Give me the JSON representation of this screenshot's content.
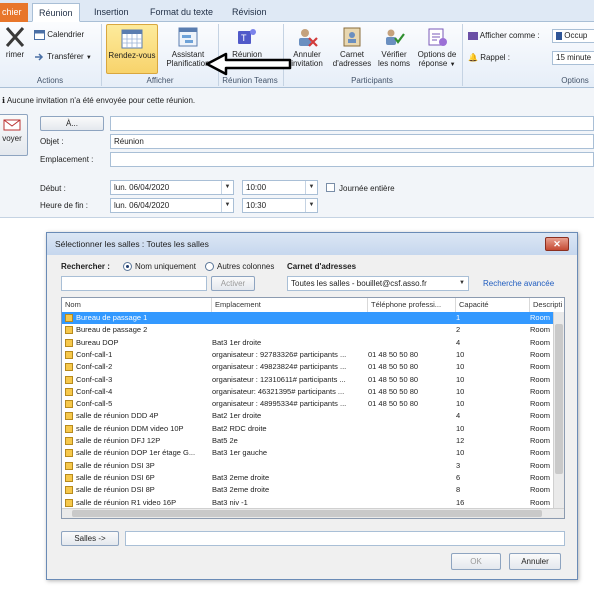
{
  "tabs": [
    "chier",
    "Réunion",
    "Insertion",
    "Format du texte",
    "Révision"
  ],
  "ribbon": {
    "actions": {
      "delete": "rimer",
      "calendar": "Calendrier",
      "forward": "Transférer",
      "group": "Actions"
    },
    "afficher": {
      "rdv": "Rendez-vous",
      "assistant1": "Assistant",
      "assistant2": "Planification",
      "group": "Afficher"
    },
    "teams": {
      "btn": "Réunion",
      "group": "Réunion Teams"
    },
    "participants": {
      "cancel1": "Annuler",
      "cancel2": "invitation",
      "book1": "Carnet",
      "book2": "d'adresses",
      "verify1": "Vérifier",
      "verify2": "les noms",
      "options1": "Options de",
      "options2": "réponse",
      "group": "Participants"
    },
    "options": {
      "show_as_label": "Afficher comme :",
      "show_as_value": "Occup",
      "reminder_label": "Rappel :",
      "reminder_value": "15 minute",
      "group": "Options"
    }
  },
  "form": {
    "info": "Aucune invitation n'a été envoyée pour cette réunion.",
    "send": "voyer",
    "to": "À...",
    "subject_label": "Objet :",
    "subject_value": "Réunion",
    "location_label": "Emplacement :",
    "start_label": "Début :",
    "start_date": "lun. 06/04/2020",
    "start_time": "10:00",
    "allday": "Journée entière",
    "end_label": "Heure de fin :",
    "end_date": "lun. 06/04/2020",
    "end_time": "10:30"
  },
  "dialog": {
    "title": "Sélectionner les salles : Toutes les salles",
    "search_label": "Rechercher :",
    "name_only": "Nom uniquement",
    "other_cols": "Autres colonnes",
    "address_book_label": "Carnet d'adresses",
    "activate": "Activer",
    "book_value": "Toutes les salles - bouillet@csf.asso.fr",
    "advanced": "Recherche avancée",
    "columns": [
      "Nom",
      "Emplacement",
      "Téléphone professi...",
      "Capacité",
      "Descripti"
    ],
    "rows": [
      [
        "Bureau de passage 1",
        "",
        "",
        "1",
        "Room"
      ],
      [
        "Bureau de passage 2",
        "",
        "",
        "2",
        "Room"
      ],
      [
        "Bureau DOP",
        "Bat3 1er droite",
        "",
        "4",
        "Room"
      ],
      [
        "Conf-call-1",
        "organisateur : 92783326# participants ...",
        "01 48 50 50 80",
        "10",
        "Room"
      ],
      [
        "Conf-call-2",
        "organisateur : 49823824# participants ...",
        "01 48 50 50 80",
        "10",
        "Room"
      ],
      [
        "Conf-call-3",
        "organisateur : 12310611# participants ...",
        "01 48 50 50 80",
        "10",
        "Room"
      ],
      [
        "Conf-call-4",
        "organisateur: 46321395# participants ...",
        "01 48 50 50 80",
        "10",
        "Room"
      ],
      [
        "Conf-call-5",
        "organisateur : 48995334# participants ...",
        "01 48 50 50 80",
        "10",
        "Room"
      ],
      [
        "salle de réunion DDD 4P",
        "Bat2 1er droite",
        "",
        "4",
        "Room"
      ],
      [
        "salle de réunion DDM video 10P",
        "Bat2 RDC droite",
        "",
        "10",
        "Room"
      ],
      [
        "salle de réunion DFJ 12P",
        "Bat5 2e",
        "",
        "12",
        "Room"
      ],
      [
        "salle de réunion DOP 1er étage G...",
        "Bat3 1er gauche",
        "",
        "10",
        "Room"
      ],
      [
        "salle de réunion DSI 3P",
        "",
        "",
        "3",
        "Room"
      ],
      [
        "salle de réunion DSI 6P",
        "Bat3 2eme droite",
        "",
        "6",
        "Room"
      ],
      [
        "salle de réunion DSI 8P",
        "Bat3 2eme droite",
        "",
        "8",
        "Room"
      ],
      [
        "salle de réunion R1 video 16P",
        "Bat3 niv -1",
        "",
        "16",
        "Room"
      ]
    ],
    "rooms_btn": "Salles ->",
    "ok": "OK",
    "cancel": "Annuler"
  }
}
